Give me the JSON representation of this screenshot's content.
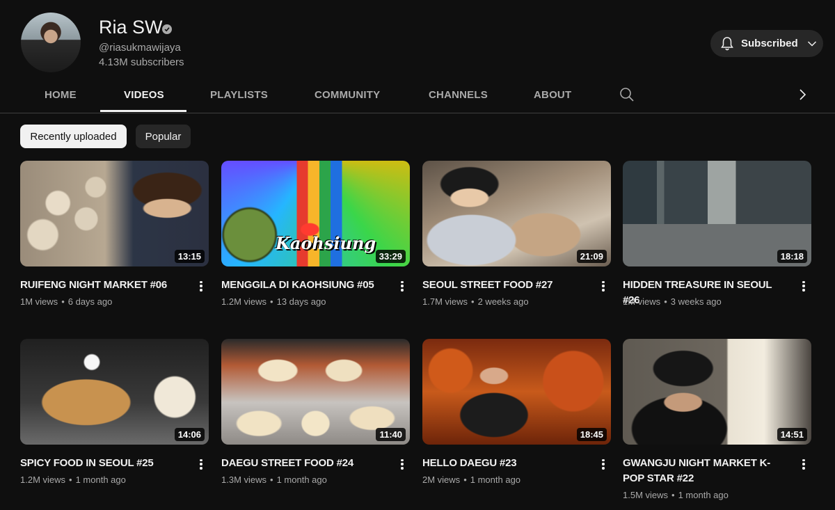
{
  "channel": {
    "name": "Ria SW",
    "handle": "@riasukmawijaya",
    "subscribers": "4.13M subscribers",
    "subscribe_button": "Subscribed"
  },
  "tabs": [
    "HOME",
    "VIDEOS",
    "PLAYLISTS",
    "COMMUNITY",
    "CHANNELS",
    "ABOUT"
  ],
  "active_tab": "VIDEOS",
  "chips": {
    "recent": "Recently uploaded",
    "popular": "Popular"
  },
  "videos": [
    {
      "title": "RUIFENG NIGHT MARKET #06",
      "duration": "13:15",
      "views": "1M views",
      "age": "6 days ago"
    },
    {
      "title": "MENGGILA DI KAOHSIUNG #05",
      "duration": "33:29",
      "views": "1.2M views",
      "age": "13 days ago"
    },
    {
      "title": "SEOUL STREET FOOD #27",
      "duration": "21:09",
      "views": "1.7M views",
      "age": "2 weeks ago"
    },
    {
      "title": "HIDDEN TREASURE IN SEOUL #26",
      "duration": "18:18",
      "views": "1M views",
      "age": "3 weeks ago"
    },
    {
      "title": "SPICY FOOD IN SEOUL #25",
      "duration": "14:06",
      "views": "1.2M views",
      "age": "1 month ago"
    },
    {
      "title": "DAEGU STREET FOOD #24",
      "duration": "11:40",
      "views": "1.3M views",
      "age": "1 month ago"
    },
    {
      "title": "HELLO DAEGU #23",
      "duration": "18:45",
      "views": "2M views",
      "age": "1 month ago"
    },
    {
      "title": "GWANGJU NIGHT MARKET K-POP STAR #22",
      "duration": "14:51",
      "views": "1.5M views",
      "age": "1 month ago"
    }
  ],
  "meta_separator": "•",
  "thumbnail_text": {
    "kaohsiung": "Kaohsiung"
  },
  "colors": {
    "background": "#0f0f0f",
    "text": "#f1f1f1",
    "secondary_text": "#aaaaaa",
    "chip_active": "#f1f1f1",
    "chip": "#272727"
  }
}
